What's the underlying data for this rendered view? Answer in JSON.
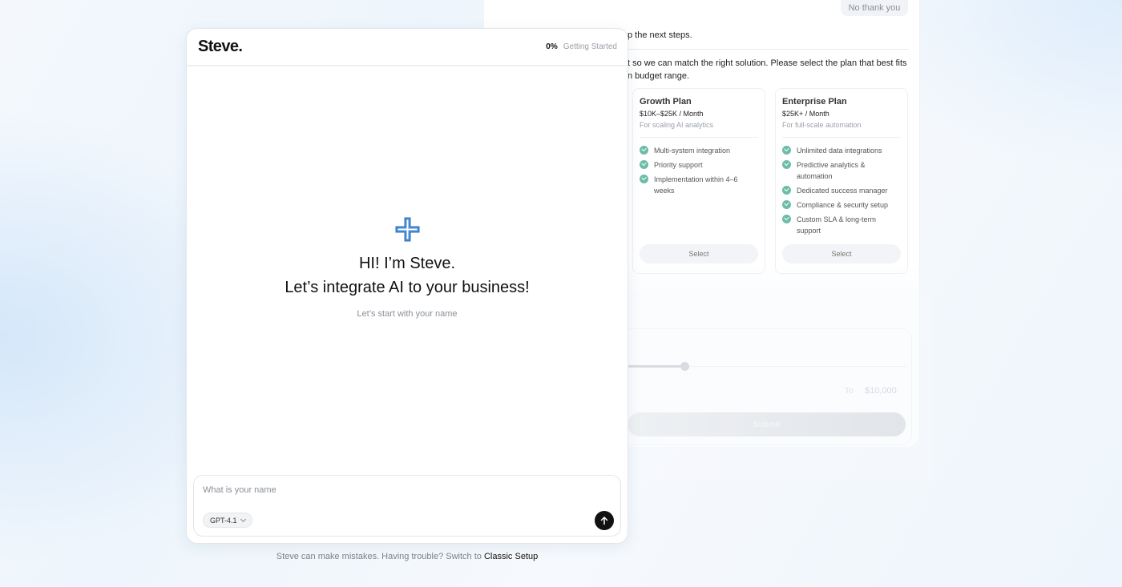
{
  "background": {
    "no_thanks_label": "No thank you",
    "text_line1": "p the next steps.",
    "text_line2": "t so we can match the right solution. Please select the plan that best fits",
    "text_line3": "n budget range.",
    "plans": [
      {
        "name": "Growth Plan",
        "price": "$10K–$25K / Month",
        "subtitle": "For scaling AI analytics",
        "features": [
          "Multi-system integration",
          "Priority support",
          "Implementation within 4–6 weeks"
        ],
        "select_label": "Select"
      },
      {
        "name": "Enterprise Plan",
        "price": "$25K+ / Month",
        "subtitle": "For full-scale automation",
        "features": [
          "Unlimited data integrations",
          "Predictive analytics & automation",
          "Dedicated success manager",
          "Compliance & security setup",
          "Custom SLA & long-term support"
        ],
        "select_label": "Select"
      }
    ],
    "budget": {
      "to_label": "To",
      "to_value": "$10,000",
      "submit_label": "Submit"
    }
  },
  "chat": {
    "logo": "Steve.",
    "progress_percent": "0%",
    "progress_label": "Getting Started",
    "hero_line1": "HI! I’m Steve.",
    "hero_line2": "Let’s integrate AI to your business!",
    "hero_sub": "Let’s start with your name",
    "input_placeholder": "What is your name",
    "input_value": "",
    "model": "GPT-4.1"
  },
  "footer": {
    "text": "Steve can make mistakes. Having trouble? Switch to",
    "link": "Classic Setup"
  },
  "colors": {
    "accent_check": "#6cbda7",
    "plus_icon": "#4a8fd9",
    "send_button": "#111111"
  },
  "icons": {
    "plus": "plus-sparkle-icon",
    "check": "check-circle-icon",
    "chevron": "chevron-down-icon",
    "send": "arrow-up-icon"
  }
}
